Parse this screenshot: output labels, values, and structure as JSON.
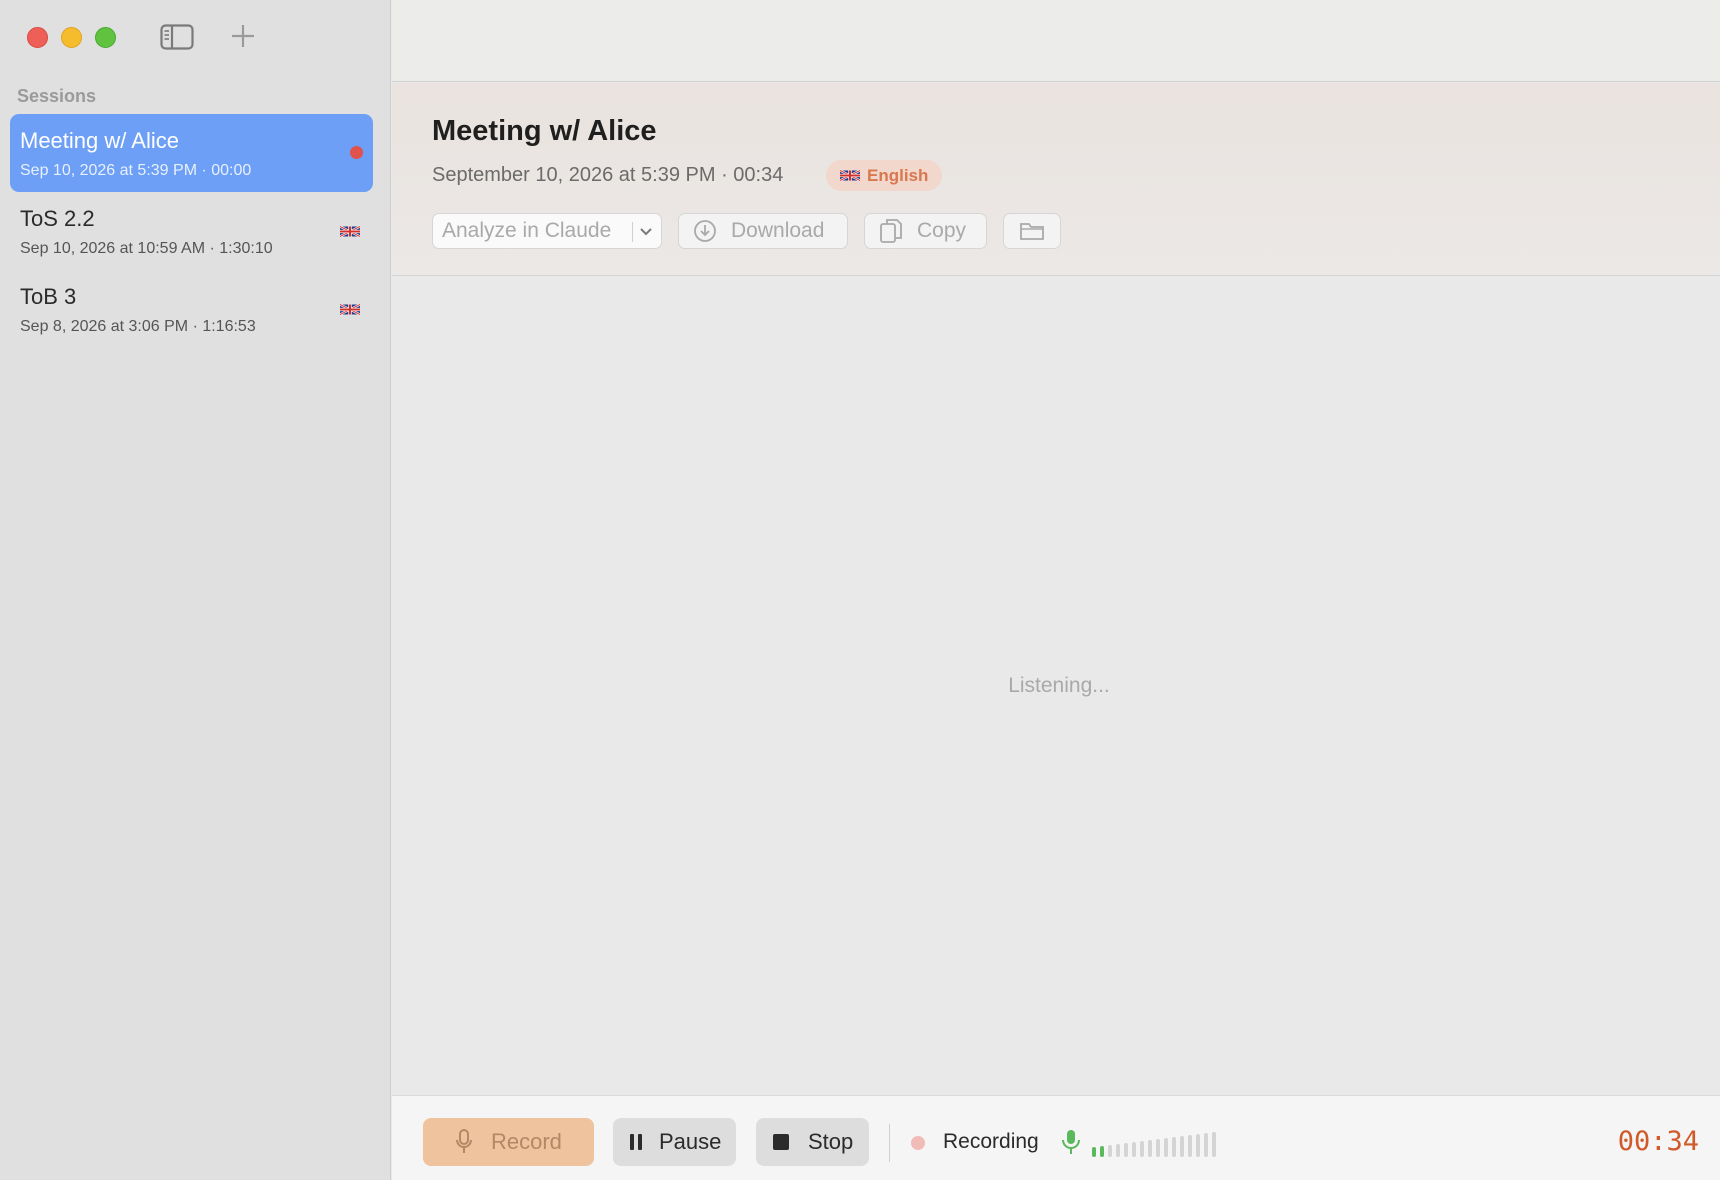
{
  "sidebar": {
    "section_title": "Sessions",
    "sessions": [
      {
        "title": "Meeting w/ Alice",
        "subtitle": "Sep 10, 2026 at 5:39 PM · 00:00",
        "indicator": "recording-dot",
        "selected": true
      },
      {
        "title": "ToS 2.2",
        "subtitle": "Sep 10, 2026 at 10:59 AM · 1:30:10",
        "indicator": "uk-flag-icon",
        "selected": false
      },
      {
        "title": "ToB 3",
        "subtitle": "Sep 8, 2026 at 3:06 PM · 1:16:53",
        "indicator": "uk-flag-icon",
        "selected": false
      }
    ]
  },
  "header": {
    "title": "Meeting w/ Alice",
    "subtitle": "September 10, 2026 at 5:39 PM · 00:34",
    "language": "English",
    "language_flag_icon": "uk-flag-icon"
  },
  "toolbar": {
    "analyze_label": "Analyze in Claude",
    "download_label": "Download",
    "copy_label": "Copy",
    "folder_icon": "folder-icon"
  },
  "content": {
    "status_text": "Listening..."
  },
  "controls": {
    "record_label": "Record",
    "pause_label": "Pause",
    "stop_label": "Stop",
    "status_label": "Recording",
    "input_level_active_bars": 2,
    "input_level_total_bars": 16,
    "timer": "00:34"
  },
  "colors": {
    "accent_selected": "#6c9ff5",
    "record_dot": "#e0524b",
    "language_badge_bg": "#f1d7cc",
    "language_badge_text": "#d9774e",
    "record_button_bg": "#efc39d",
    "timer": "#d05a2a",
    "level_active": "#5cb85c"
  }
}
